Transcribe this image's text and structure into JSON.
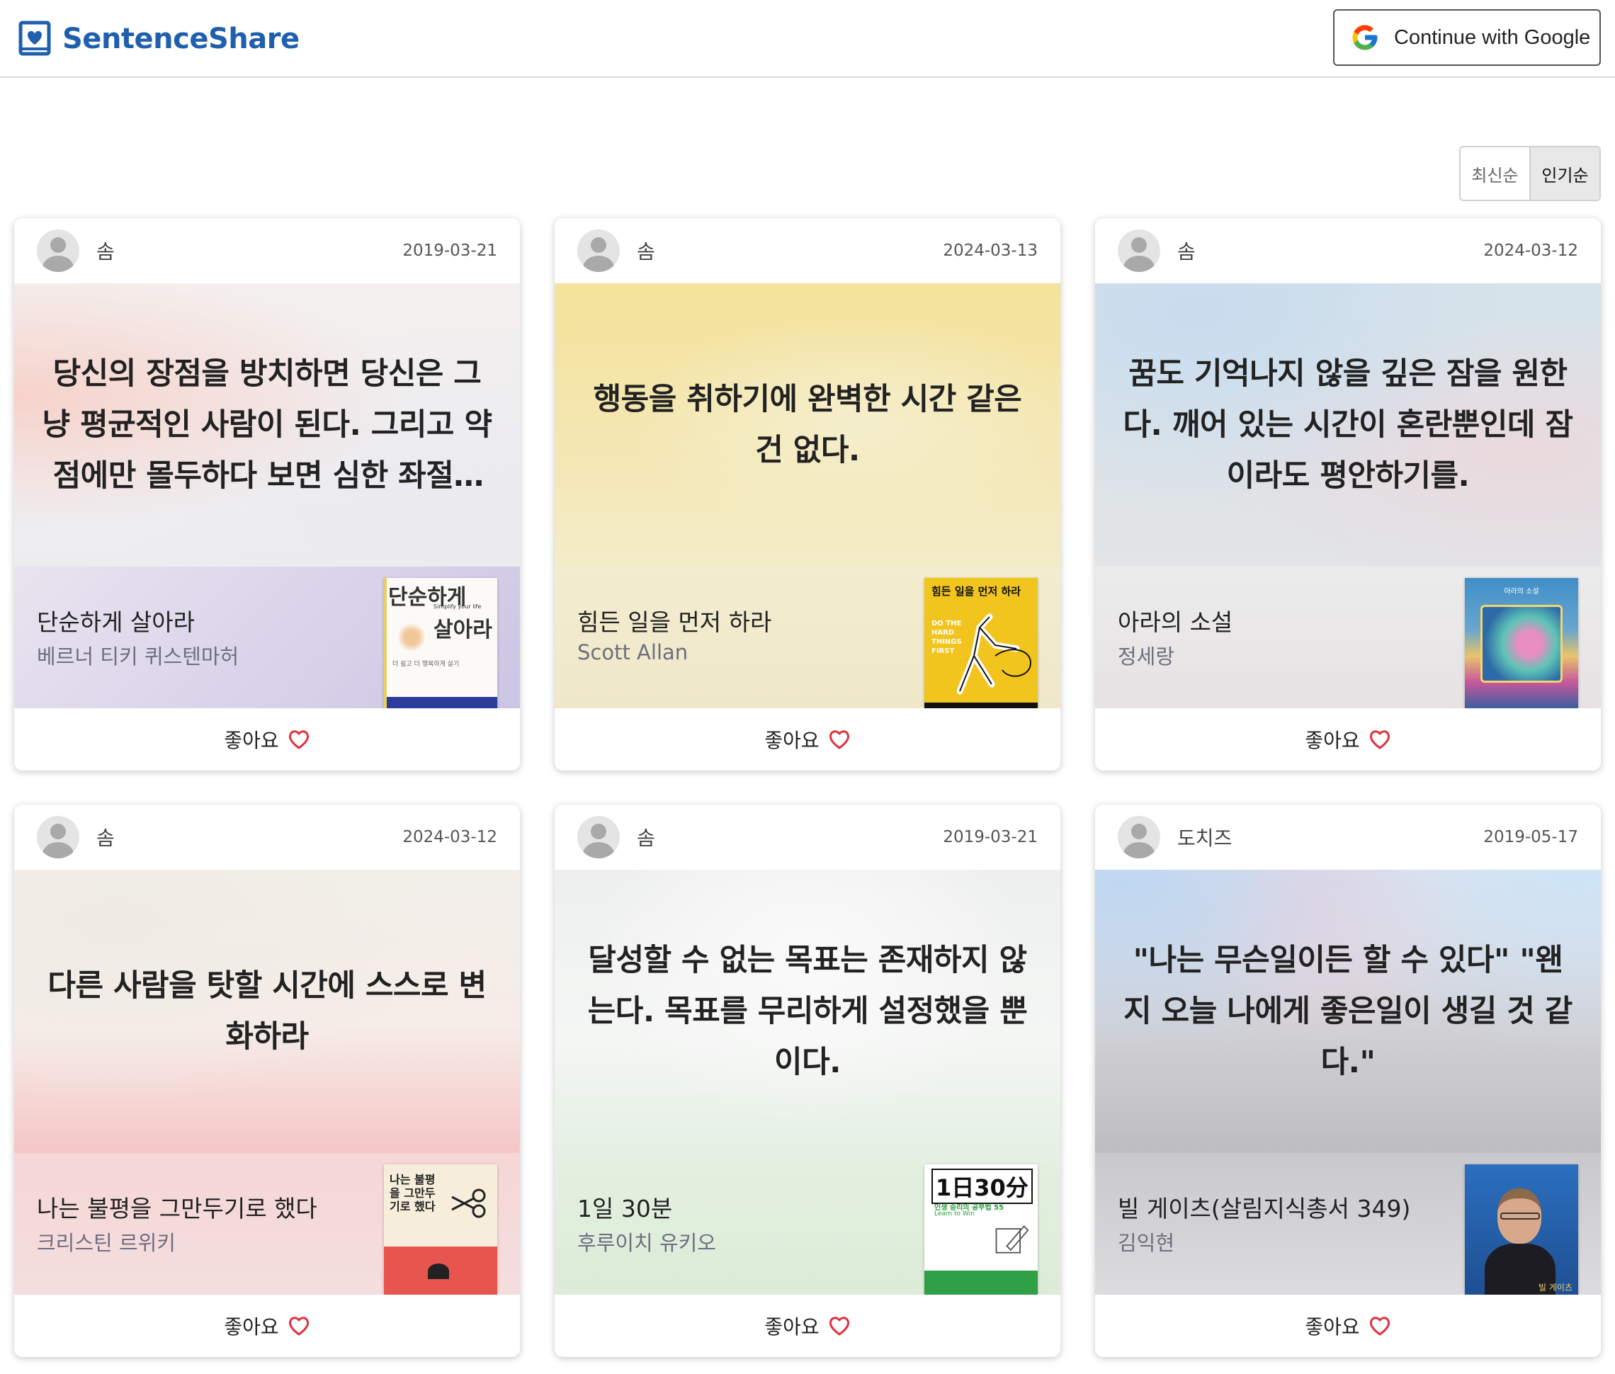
{
  "header": {
    "logo_text": "SentenceShare",
    "google_button_label": "Continue with Google"
  },
  "sort": {
    "options": [
      "최신순",
      "인기순"
    ],
    "active": "인기순"
  },
  "cards": [
    {
      "user": "솜",
      "date": "2019-03-21",
      "quote": "당신의 장점을 방치하면 당신은 그냥 평균적인 사람이 된다. 그리고 약점에만 몰두하다 보면 심한 좌절감에 빠지게 된다.",
      "book_title": "단순하게 살아라",
      "book_author": "베르너 티키 퀴스텐마허",
      "cover_title_1": "단순하게",
      "cover_title_2": "살아라",
      "cover_subtitle": "Simplify your life",
      "cover_tagline": "더 쉽고 더 행복하게 살기",
      "like_label": "좋아요"
    },
    {
      "user": "솜",
      "date": "2024-03-13",
      "quote": "행동을 취하기에 완벽한 시간 같은 건 없다.",
      "book_title": "힘든 일을 먼저 하라",
      "book_author": "Scott Allan",
      "cover_title_1": "힘든 일을 먼저 하라",
      "cover_subtitle": "DO THE HARD THINGS FIRST",
      "like_label": "좋아요"
    },
    {
      "user": "솜",
      "date": "2024-03-12",
      "quote": "꿈도 기억나지 않을 깊은 잠을 원한다. 깨어 있는 시간이 혼란뿐인데 잠이라도 평안하기를.",
      "book_title": "아라의 소설",
      "book_author": "정세랑",
      "cover_title_1": "아라의 소설",
      "like_label": "좋아요"
    },
    {
      "user": "솜",
      "date": "2024-03-12",
      "quote": "다른 사람을 탓할 시간에 스스로 변화하라",
      "book_title": "나는 불평을 그만두기로 했다",
      "book_author": "크리스틴 르위키",
      "cover_title_1": "나는 불평을 그만두기로 했다",
      "like_label": "좋아요"
    },
    {
      "user": "솜",
      "date": "2019-03-21",
      "quote": "달성할 수 없는 목표는 존재하지 않는다. 목표를 무리하게 설정했을 뿐이다.",
      "book_title": "1일 30분",
      "book_author": "후루이치 유키오",
      "cover_title_1": "1日30分",
      "cover_subtitle": "인생 승리의 공부법 55",
      "cover_tagline": "Learn to Win",
      "like_label": "좋아요"
    },
    {
      "user": "도치즈",
      "date": "2019-05-17",
      "quote": "\"나는 무슨일이든 할 수 있다\" \"왠지 오늘 나에게 좋은일이 생길 것 같다.\"",
      "book_title": "빌 게이츠(살림지식총서 349)",
      "book_author": "김익현",
      "cover_title_1": "빌 게이츠",
      "like_label": "좋아요"
    }
  ],
  "colors": {
    "brand": "#1f5fae",
    "heart": "#e0313b"
  }
}
